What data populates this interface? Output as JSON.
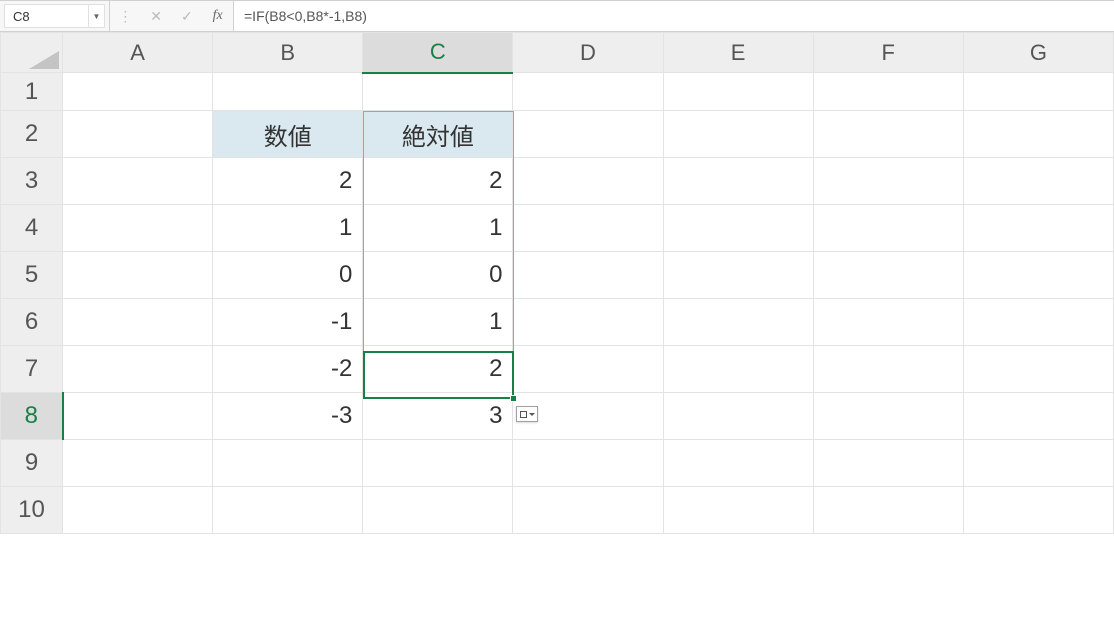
{
  "formula_bar": {
    "cell_ref": "C8",
    "formula": "=IF(B8<0,B8*-1,B8)"
  },
  "columns": [
    "A",
    "B",
    "C",
    "D",
    "E",
    "F",
    "G"
  ],
  "rows": [
    "1",
    "2",
    "3",
    "4",
    "5",
    "6",
    "7",
    "8",
    "9",
    "10"
  ],
  "selected_col": "C",
  "selected_row": "8",
  "table_header": {
    "b2": "数値",
    "c2": "絶対値"
  },
  "table_rows": [
    {
      "b": "2",
      "c": "2"
    },
    {
      "b": "1",
      "c": "1"
    },
    {
      "b": "0",
      "c": "0"
    },
    {
      "b": "-1",
      "c": "1"
    },
    {
      "b": "-2",
      "c": "2"
    },
    {
      "b": "-3",
      "c": "3"
    }
  ],
  "icons": {
    "dropdown": "▼",
    "more": "⋮",
    "cancel": "✕",
    "enter": "✓",
    "fx": "fx"
  }
}
